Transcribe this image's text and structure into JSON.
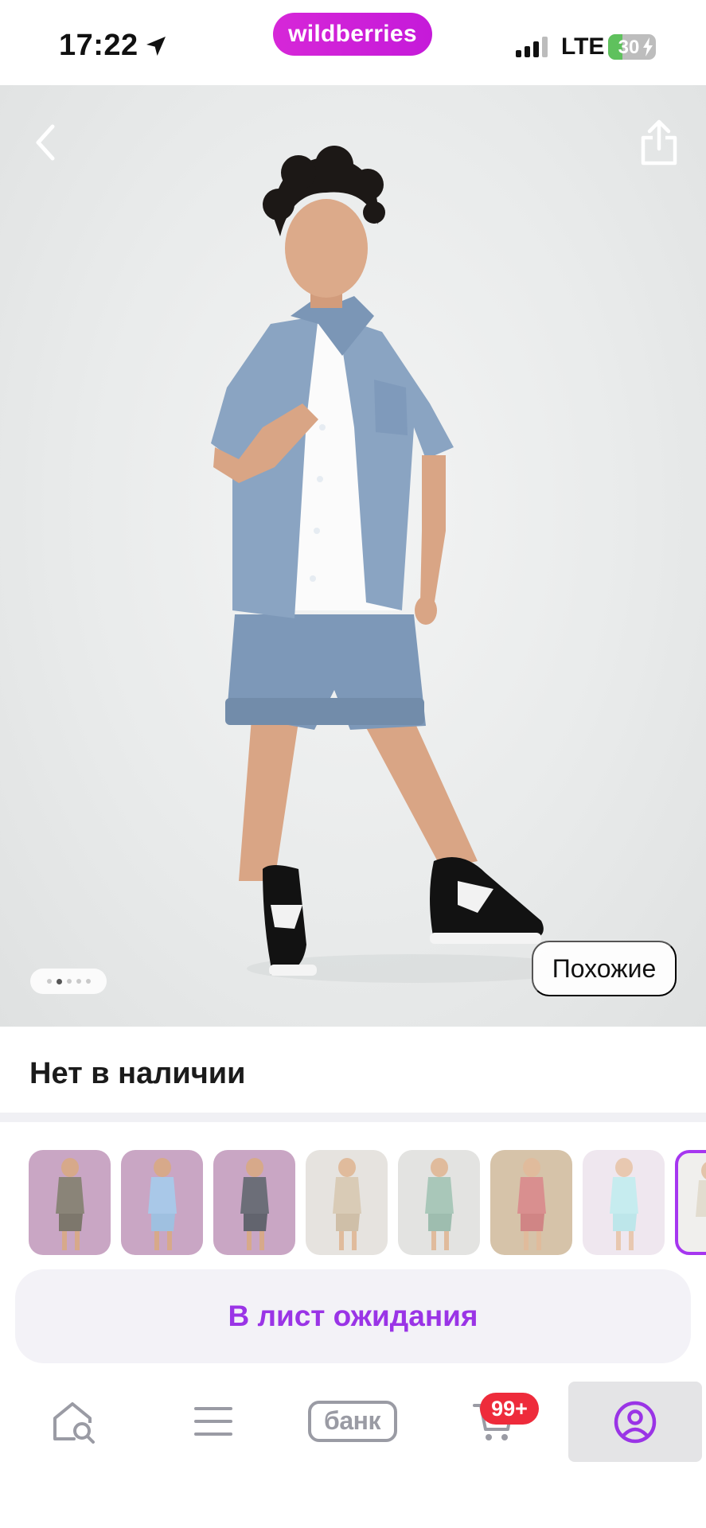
{
  "status_bar": {
    "time": "17:22",
    "network": "LTE",
    "battery_percent": "30",
    "battery_level": 0.3,
    "brand": "wildberries"
  },
  "product_image": {
    "gallery_pages": 5,
    "active_page": 2,
    "similar_button": "Похожие"
  },
  "availability": {
    "status": "Нет в наличии"
  },
  "variants": {
    "count": 8,
    "selected_index": 7
  },
  "waitlist": {
    "button_label": "В лист ожидания"
  },
  "tabbar": {
    "bank_label": "банк",
    "cart_badge": "99+",
    "active_tab": "profile"
  },
  "colors": {
    "brand": "#cb21d9",
    "accent": "#9a34e6",
    "badge": "#ee2b3b",
    "tab_icon": "#9a9ba4"
  },
  "icons": [
    "location-arrow-icon",
    "back-chevron-icon",
    "share-icon",
    "home-search-icon",
    "menu-icon",
    "cart-icon",
    "profile-icon"
  ]
}
